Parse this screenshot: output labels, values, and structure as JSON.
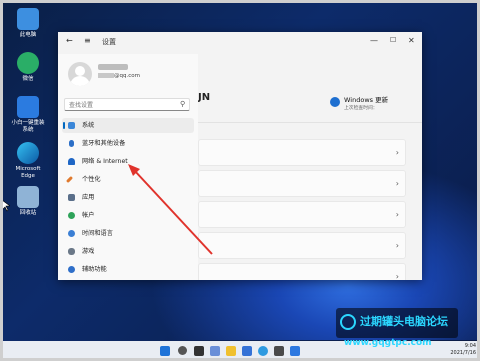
{
  "desktop": {
    "icons": [
      {
        "label": "此电脑"
      },
      {
        "label": "微信"
      },
      {
        "label": "小白一键重装\n系统"
      },
      {
        "label": "Microsoft\nEdge"
      },
      {
        "label": "回收站"
      }
    ]
  },
  "window": {
    "title": "设置",
    "account_email": "@qq.com",
    "search_placeholder": "查找设置",
    "header_suffix": "JN",
    "windows_update": {
      "title": "Windows 更新",
      "subtitle": "上次检查时间："
    },
    "nav": [
      {
        "label": "系统"
      },
      {
        "label": "蓝牙和其他设备"
      },
      {
        "label": "网络 & Internet"
      },
      {
        "label": "个性化"
      },
      {
        "label": "应用"
      },
      {
        "label": "帐户"
      },
      {
        "label": "时间和语言"
      },
      {
        "label": "游戏"
      },
      {
        "label": "辅助功能"
      }
    ]
  },
  "taskbar": {
    "time": "9:04",
    "date": "2021/7/16"
  },
  "watermark": {
    "title": "过期罐头电脑论坛",
    "url": "www.gqgtpc.com"
  },
  "colors": {
    "accent": "#0067c0",
    "arrow": "#e0332c"
  }
}
